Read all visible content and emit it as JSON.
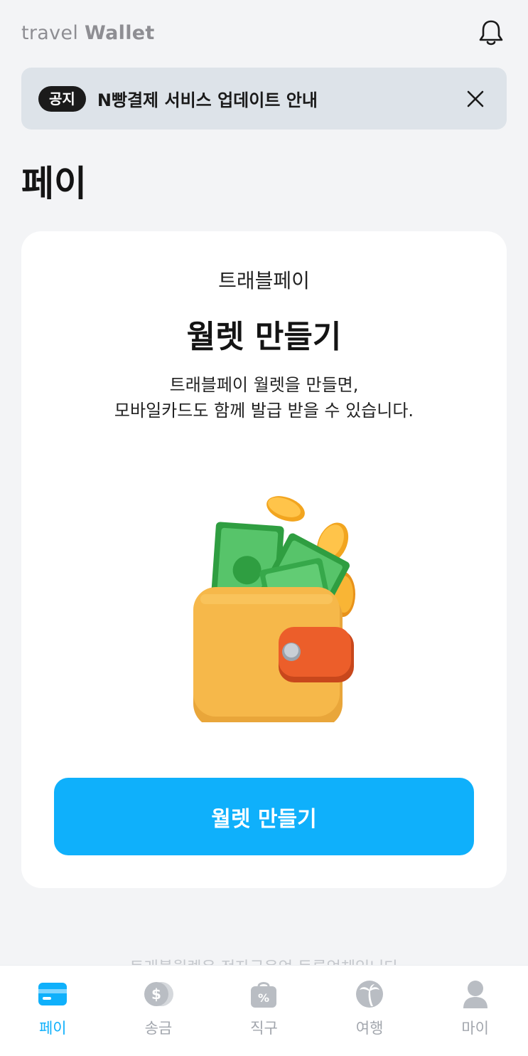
{
  "header": {
    "logo_light": "travel ",
    "logo_bold": "Wallet",
    "bell_icon": "bell-icon"
  },
  "notice": {
    "badge": "공지",
    "text": "N빵결제 서비스 업데이트 안내",
    "close_icon": "close-icon"
  },
  "page": {
    "title": "페이"
  },
  "card": {
    "subtitle": "트래블페이",
    "title": "월렛 만들기",
    "desc_line1": "트래블페이 월렛을 만들면,",
    "desc_line2": "모바일카드도 함께 발급 받을 수 있습니다.",
    "illustration": "wallet-with-cash-and-coins",
    "button_label": "월렛 만들기"
  },
  "footer_hidden_text": "트래블월렛은 전자금융업 등록업체입니다",
  "tabs": [
    {
      "label": "페이",
      "icon": "card-icon",
      "active": true
    },
    {
      "label": "송금",
      "icon": "dollar-coin-icon",
      "active": false
    },
    {
      "label": "직구",
      "icon": "shopping-bag-icon",
      "active": false
    },
    {
      "label": "여행",
      "icon": "palm-tree-icon",
      "active": false
    },
    {
      "label": "마이",
      "icon": "person-icon",
      "active": false
    }
  ],
  "colors": {
    "accent": "#0fb0fb",
    "background": "#f3f4f6",
    "notice_bg": "#dde3e9",
    "inactive_tab": "#a2a6ad"
  }
}
